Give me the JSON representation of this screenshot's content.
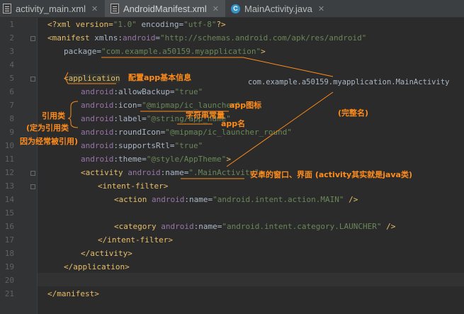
{
  "tabs": [
    {
      "label": "activity_main.xml",
      "icon": "xml-file-icon",
      "active": false
    },
    {
      "label": "AndroidManifest.xml",
      "icon": "xml-file-icon",
      "active": true
    },
    {
      "label": "MainActivity.java",
      "icon": "java-class-icon",
      "active": false
    }
  ],
  "line_numbers": [
    "1",
    "2",
    "3",
    "4",
    "5",
    "6",
    "7",
    "8",
    "9",
    "10",
    "11",
    "12",
    "13",
    "14",
    "15",
    "16",
    "17",
    "18",
    "19",
    "20",
    "21"
  ],
  "code": {
    "l1": {
      "a": "<?xml version=",
      "b": "\"1.0\"",
      "c": " encoding=",
      "d": "\"utf-8\"",
      "e": "?>"
    },
    "l2": {
      "a": "<manifest",
      "b": " xmlns:",
      "c": "android",
      "d": "=",
      "e": "\"http://schemas.android.com/apk/res/android\""
    },
    "l3": {
      "a": "package=",
      "b": "\"com.example.a50159.myapplication\"",
      "c": ">"
    },
    "l6": {
      "a": "<",
      "b": "application"
    },
    "l7": {
      "a": "android",
      "b": ":allowBackup=",
      "c": "\"true\""
    },
    "l8": {
      "a": "android",
      "b": ":icon=",
      "c": "\"@mipmap/ic_launcher\""
    },
    "l9": {
      "a": "android",
      "b": ":label=",
      "c": "\"@string/app_name\""
    },
    "l10": {
      "a": "android",
      "b": ":roundIcon=",
      "c": "\"@mipmap/ic_launcher_round\""
    },
    "l11": {
      "a": "android",
      "b": ":supportsRtl=",
      "c": "\"true\""
    },
    "l12": {
      "a": "android",
      "b": ":theme=",
      "c": "\"@style/AppTheme\"",
      "d": ">"
    },
    "l13": {
      "a": "<activity ",
      "b": "android",
      "c": ":name=",
      "d": "\".MainActivity\"",
      "e": ">"
    },
    "l14": {
      "a": "<intent-filter>"
    },
    "l15": {
      "a": "<action ",
      "b": "android",
      "c": ":name=",
      "d": "\"android.intent.action.MAIN\"",
      "e": " />"
    },
    "l17": {
      "a": "<category ",
      "b": "android",
      "c": ":name=",
      "d": "\"android.intent.category.LAUNCHER\"",
      "e": " />"
    },
    "l18": {
      "a": "</intent-filter>"
    },
    "l19": {
      "a": "</activity>"
    },
    "l20": {
      "a": "</application>"
    },
    "l22": {
      "a": "</manifest>"
    }
  },
  "annotations": {
    "app_config": "配置app基本信息",
    "full_class_name": "com.example.a50159.myapplication.MainActivity",
    "full_name_label": "(完整名)",
    "app_icon": "app图标",
    "string_constant": "字符串常量",
    "app_name": "app名",
    "reference_class": "引用类",
    "reference_class_note1": "(定为引用类",
    "reference_class_note2": "因为经常被引用)",
    "activity_desc": "安卓的窗口、界面 (activity其实就是java类)"
  },
  "colors": {
    "annotation": "#ff8c1a",
    "tag": "#e8bf6a",
    "namespace": "#9876aa",
    "string": "#6a8759",
    "text": "#a9b7c6"
  }
}
